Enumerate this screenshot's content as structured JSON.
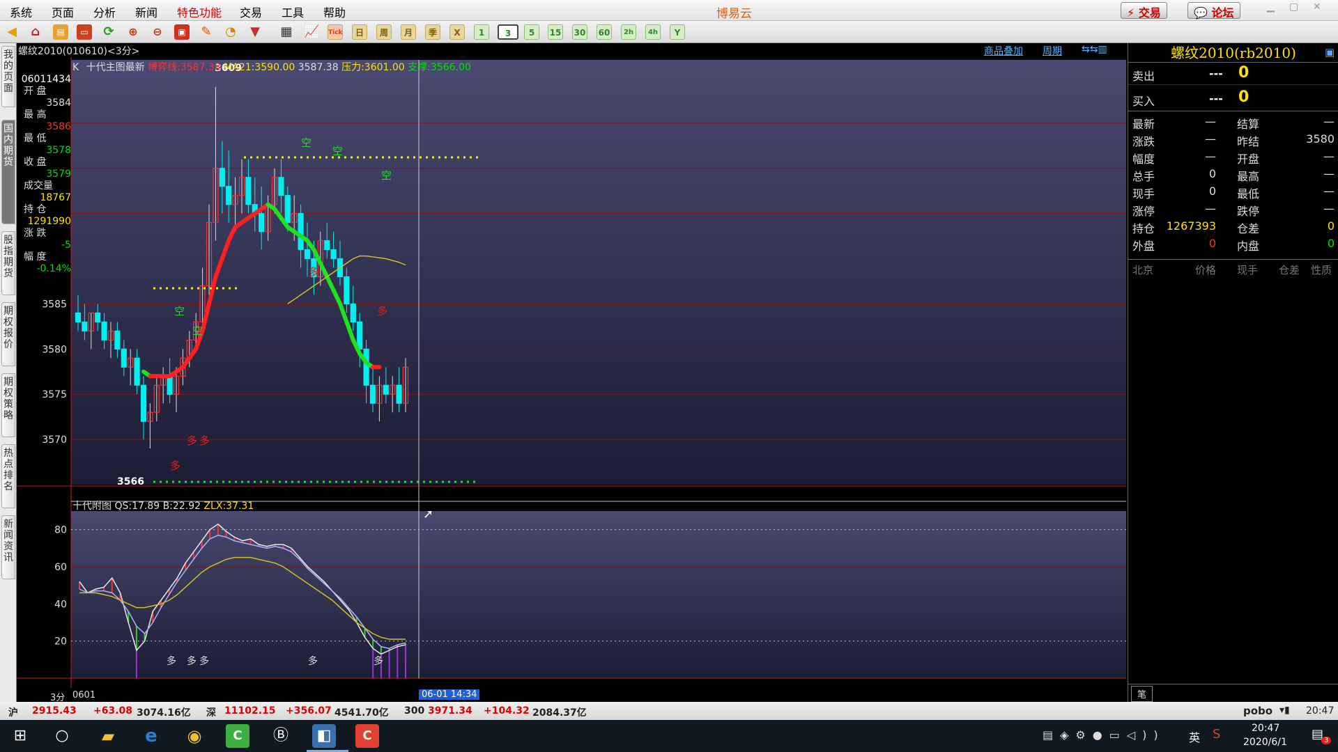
{
  "menu": {
    "items": [
      "系统",
      "页面",
      "分析",
      "新闻",
      "特色功能",
      "交易",
      "工具",
      "帮助"
    ],
    "app_title": "博易云",
    "trade_btn": "交易",
    "forum_btn": "论坛"
  },
  "toolbar": {
    "period_buttons": [
      "Tick",
      "日",
      "周",
      "月",
      "季",
      "X",
      "1",
      "3",
      "5",
      "15",
      "30",
      "60",
      "2h",
      "4h",
      "Y"
    ],
    "selected": "3"
  },
  "left_tabs": [
    "我的页面",
    "国内期货",
    "股指期货",
    "期权报价",
    "期权策略",
    "热点排名",
    "新闻资讯"
  ],
  "chart": {
    "title": "螺纹2010(010610)<3分>",
    "overlay_btn": "商品叠加",
    "period_btn": "周期",
    "main_label": "K",
    "main_name": "十代主图最新",
    "ind_bo": "博弈线:3587.38",
    "ind_ma": "MA21:3590.00",
    "ind_val": "3587.38",
    "ind_press": "压力:3601.00",
    "ind_support": "支撑:3566.00",
    "info": {
      "date": "06011434",
      "open_l": "开 盘",
      "open": "3584",
      "high_l": "最 高",
      "high": "3586",
      "low_l": "最 低",
      "low": "3578",
      "close_l": "收 盘",
      "close": "3579",
      "vol_l": "成交量",
      "vol": "18767",
      "oi_l": "持 仓",
      "oi": "1291990",
      "chg_l": "涨 跌",
      "chg": "-5",
      "amp_l": "幅 度",
      "amp": "-0.14%"
    },
    "high_mark": "3609",
    "low_mark": "3566",
    "sub_title": "十代附图",
    "sub_qs": "QS:17.89",
    "sub_b": "B:22.92",
    "sub_zlx": "ZLX:37.31",
    "bottom_period": "3分",
    "bottom_date": "0601",
    "cursor_time": "06-01 14:34",
    "sig_kong": "空",
    "sig_duo": "多",
    "colors": {
      "up": "#ff3030",
      "down": "#00f0f0",
      "grid": "#8a1010",
      "bg_top": "#46466e",
      "bg_bot": "#1a1a30"
    }
  },
  "chart_data": [
    {
      "type": "candlestick",
      "ylim": [
        3565,
        3612
      ],
      "yticks": [
        "3585",
        "3580",
        "3575",
        "3570"
      ],
      "ytick_values": [
        3585,
        3580,
        3575,
        3570
      ],
      "ohlc": [
        [
          3584,
          3586,
          3582,
          3583
        ],
        [
          3583,
          3585,
          3581,
          3582
        ],
        [
          3582,
          3584,
          3580,
          3584
        ],
        [
          3584,
          3585,
          3582,
          3583
        ],
        [
          3583,
          3584,
          3580,
          3581
        ],
        [
          3581,
          3583,
          3579,
          3582
        ],
        [
          3582,
          3583,
          3579,
          3580
        ],
        [
          3580,
          3581,
          3577,
          3578
        ],
        [
          3578,
          3580,
          3576,
          3579
        ],
        [
          3579,
          3580,
          3575,
          3576
        ],
        [
          3576,
          3577,
          3570,
          3572
        ],
        [
          3572,
          3574,
          3569,
          3573
        ],
        [
          3573,
          3577,
          3572,
          3576
        ],
        [
          3576,
          3578,
          3574,
          3577
        ],
        [
          3577,
          3579,
          3574,
          3575
        ],
        [
          3575,
          3578,
          3573,
          3577
        ],
        [
          3577,
          3580,
          3576,
          3579
        ],
        [
          3579,
          3582,
          3578,
          3581
        ],
        [
          3581,
          3584,
          3580,
          3583
        ],
        [
          3583,
          3589,
          3582,
          3587
        ],
        [
          3587,
          3596,
          3586,
          3594
        ],
        [
          3594,
          3609,
          3592,
          3600
        ],
        [
          3600,
          3603,
          3595,
          3598
        ],
        [
          3598,
          3602,
          3594,
          3596
        ],
        [
          3596,
          3599,
          3593,
          3597
        ],
        [
          3597,
          3601,
          3595,
          3599
        ],
        [
          3599,
          3601,
          3595,
          3596
        ],
        [
          3596,
          3599,
          3593,
          3595
        ],
        [
          3595,
          3598,
          3591,
          3593
        ],
        [
          3593,
          3597,
          3592,
          3596
        ],
        [
          3596,
          3600,
          3595,
          3599
        ],
        [
          3599,
          3601,
          3595,
          3597
        ],
        [
          3597,
          3598,
          3593,
          3594
        ],
        [
          3594,
          3597,
          3592,
          3595
        ],
        [
          3595,
          3596,
          3589,
          3591
        ],
        [
          3591,
          3594,
          3588,
          3590
        ],
        [
          3590,
          3592,
          3586,
          3588
        ],
        [
          3588,
          3593,
          3587,
          3592
        ],
        [
          3592,
          3594,
          3590,
          3591
        ],
        [
          3591,
          3593,
          3589,
          3590
        ],
        [
          3590,
          3592,
          3587,
          3588
        ],
        [
          3588,
          3589,
          3584,
          3585
        ],
        [
          3585,
          3587,
          3582,
          3583
        ],
        [
          3583,
          3584,
          3578,
          3580
        ],
        [
          3580,
          3581,
          3574,
          3576
        ],
        [
          3576,
          3578,
          3573,
          3574
        ],
        [
          3574,
          3577,
          3572,
          3576
        ],
        [
          3576,
          3578,
          3574,
          3575
        ],
        [
          3575,
          3577,
          3573,
          3576
        ],
        [
          3576,
          3578,
          3573,
          3574
        ],
        [
          3574,
          3579,
          3573,
          3578
        ]
      ],
      "series": [
        {
          "name": "博弈线",
          "values": [
            null,
            null,
            null,
            null,
            null,
            null,
            null,
            null,
            null,
            null,
            3577.5,
            3577,
            3577,
            3577,
            3577,
            3577.5,
            3578,
            3579,
            3580,
            3582,
            3585,
            3588,
            3590,
            3592,
            3593.5,
            3594,
            3594.5,
            3595,
            3595.5,
            3596,
            3595.5,
            3594.5,
            3593.5,
            3593,
            3592.5,
            3592,
            3591,
            3589.5,
            3588,
            3586.5,
            3585,
            3583,
            3581,
            3579.5,
            3578.5,
            3578,
            3578
          ]
        },
        {
          "name": "MA21",
          "values": [
            null,
            null,
            null,
            null,
            null,
            null,
            null,
            null,
            null,
            null,
            null,
            null,
            null,
            null,
            null,
            null,
            null,
            null,
            null,
            null,
            null,
            null,
            null,
            null,
            null,
            null,
            null,
            null,
            null,
            null,
            null,
            null,
            3585,
            3585.5,
            3586,
            3586.5,
            3587,
            3587.5,
            3588,
            3588.5,
            3589,
            3589.5,
            3590,
            3590.3,
            3590.3,
            3590.2,
            3590.1,
            3590,
            3589.8,
            3589.6,
            3589.3
          ]
        }
      ]
    },
    {
      "type": "line",
      "ylim": [
        0,
        90
      ],
      "yticks": [
        "80",
        "60",
        "40",
        "20"
      ],
      "ytick_values": [
        80,
        60,
        40,
        20
      ],
      "series": [
        {
          "name": "QS",
          "values": [
            52,
            46,
            48,
            49,
            54,
            46,
            30,
            15,
            20,
            36,
            42,
            48,
            54,
            62,
            68,
            74,
            80,
            83,
            79,
            76,
            74,
            75,
            72,
            71,
            72,
            72,
            70,
            65,
            60,
            56,
            52,
            47,
            42,
            37,
            30,
            22,
            16,
            13,
            15,
            17,
            18
          ]
        },
        {
          "name": "B",
          "values": [
            48,
            46,
            47,
            47,
            46,
            42,
            36,
            28,
            24,
            30,
            38,
            45,
            52,
            58,
            64,
            70,
            75,
            77,
            76,
            74,
            73,
            72,
            71,
            70,
            71,
            70,
            68,
            64,
            59,
            55,
            51,
            47,
            43,
            38,
            33,
            27,
            21,
            17,
            16,
            18,
            19
          ]
        },
        {
          "name": "ZLX",
          "values": [
            46,
            46,
            46,
            45,
            44,
            42,
            40,
            38,
            38,
            39,
            40,
            42,
            45,
            49,
            53,
            57,
            60,
            62,
            64,
            65,
            65,
            65,
            64,
            63,
            62,
            60,
            57,
            54,
            51,
            48,
            45,
            42,
            38,
            34,
            30,
            27,
            24,
            22,
            21,
            21,
            21
          ]
        }
      ]
    }
  ],
  "quote": {
    "title": "螺纹2010(rb2010)",
    "sell_l": "卖出",
    "sell_p": "---",
    "sell_v": "0",
    "buy_l": "买入",
    "buy_p": "---",
    "buy_v": "0",
    "rows": [
      [
        "最新",
        "—",
        "结算",
        "—"
      ],
      [
        "涨跌",
        "—",
        "昨结",
        "3580"
      ],
      [
        "幅度",
        "—",
        "开盘",
        "—"
      ],
      [
        "总手",
        "0",
        "最高",
        "—"
      ],
      [
        "现手",
        "0",
        "最低",
        "—"
      ],
      [
        "涨停",
        "—",
        "跌停",
        "—"
      ],
      [
        "持仓",
        "1267393",
        "仓差",
        "0"
      ],
      [
        "外盘",
        "0",
        "内盘",
        "0"
      ]
    ],
    "trade_hdr": [
      "北京",
      "价格",
      "现手",
      "仓差",
      "性质"
    ],
    "bottom_tab": "笔"
  },
  "status": {
    "sh_l": "沪",
    "sh": "2915.43",
    "sh_chg": "+63.08",
    "sh_amt": "3074.16亿",
    "sz_l": "深",
    "sz": "11102.15",
    "sz_chg": "+356.07",
    "sz_amt": "4541.70亿",
    "hs_l": "300",
    "hs": "3971.34",
    "hs_chg": "+104.32",
    "hs_amt": "2084.37亿",
    "brand": "pobo",
    "time": "20:47"
  },
  "taskbar": {
    "time": "20:47",
    "date": "2020/6/1",
    "lang": "英",
    "notif": "3"
  }
}
